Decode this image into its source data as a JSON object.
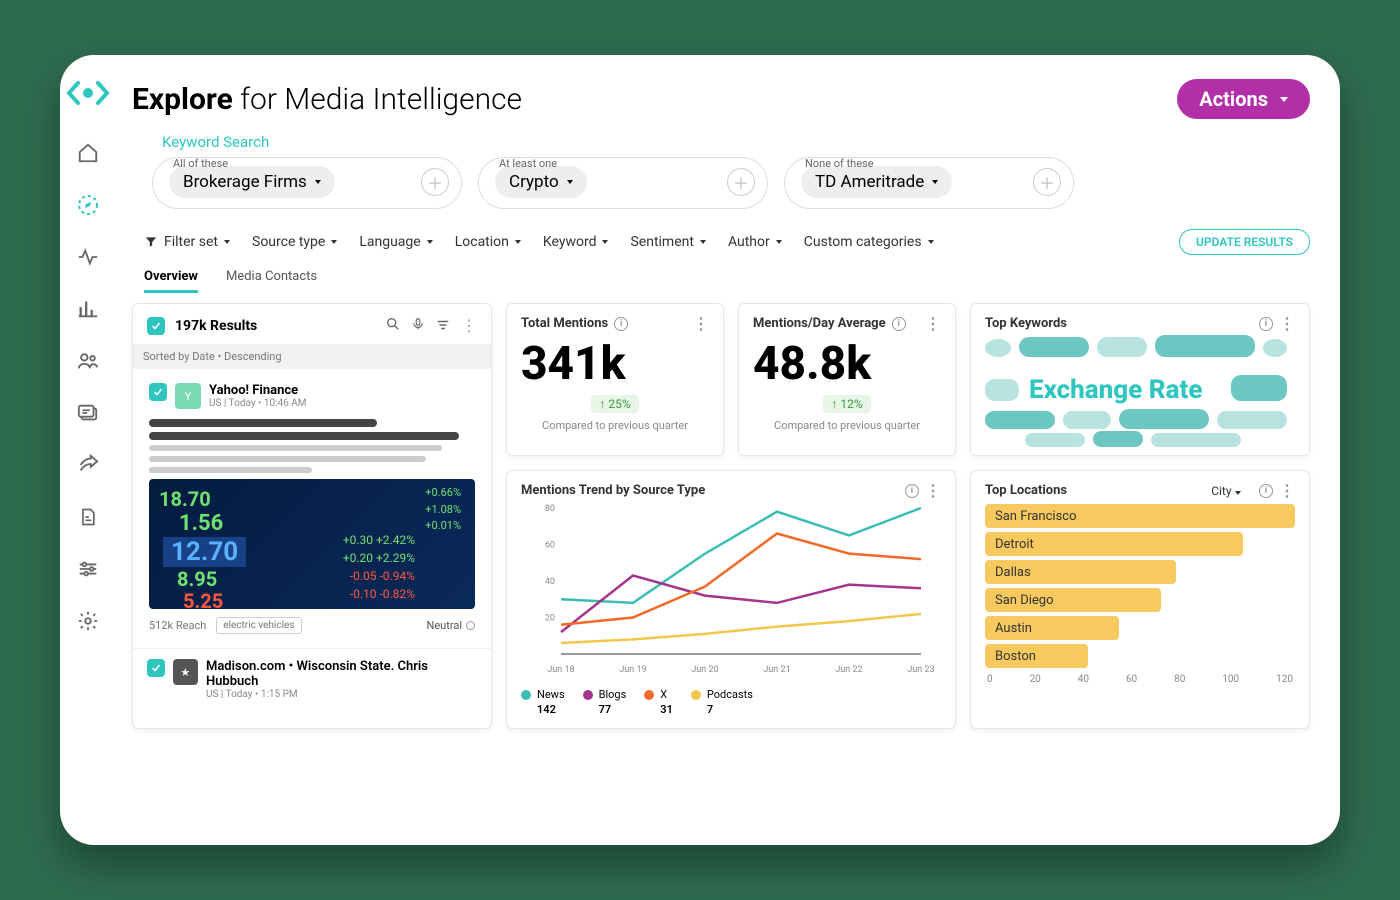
{
  "title_bold": "Explore",
  "title_rest": " for Media Intelligence",
  "actions_label": "Actions",
  "section_label": "Keyword Search",
  "search_groups": [
    {
      "label": "All of these",
      "value": "Brokerage Firms"
    },
    {
      "label": "At least one",
      "value": "Crypto"
    },
    {
      "label": "None of these",
      "value": "TD Ameritrade"
    }
  ],
  "filters": [
    "Filter set",
    "Source type",
    "Language",
    "Location",
    "Keyword",
    "Sentiment",
    "Author",
    "Custom categories"
  ],
  "update_btn": "UPDATE RESULTS",
  "tabs": [
    "Overview",
    "Media Contacts"
  ],
  "results": {
    "count": "197k Results",
    "sort": "Sorted by Date • Descending",
    "article": {
      "source": "Yahoo! Finance",
      "meta": "US  | Today • 10:46 AM",
      "reach": "512k Reach",
      "tag": "electric vehicles",
      "sentiment": "Neutral"
    },
    "next": {
      "line": "Madison.com • Wisconsin State. Chris Hubbuch",
      "meta": "US | Today • 1:15 PM"
    }
  },
  "total_mentions": {
    "title": "Total Mentions",
    "value": "341k",
    "pct": "↑ 25%",
    "compare": "Compared to previous quarter"
  },
  "avg_mentions": {
    "title": "Mentions/Day Average",
    "value": "48.8k",
    "pct": "↑ 12%",
    "compare": "Compared to previous quarter"
  },
  "keywords": {
    "title": "Top Keywords",
    "main": "Exchange Rate"
  },
  "trend": {
    "title": "Mentions Trend by Source Type"
  },
  "locations": {
    "title": "Top Locations",
    "group": "City"
  },
  "chart_data": [
    {
      "type": "line",
      "title": "Mentions Trend by Source Type",
      "xlabel": "",
      "ylabel": "",
      "categories": [
        "Jun 18",
        "Jun 19",
        "Jun 20",
        "Jun 21",
        "Jun 22",
        "Jun 23"
      ],
      "ylim": [
        0,
        80
      ],
      "series": [
        {
          "name": "News",
          "color": "#3bbdb6",
          "values": [
            30,
            28,
            55,
            78,
            65,
            80
          ],
          "legend_value": 142
        },
        {
          "name": "Blogs",
          "color": "#a4358d",
          "values": [
            12,
            43,
            32,
            28,
            38,
            36
          ],
          "legend_value": 77
        },
        {
          "name": "X",
          "color": "#f06a2b",
          "values": [
            16,
            20,
            37,
            66,
            55,
            52
          ],
          "legend_value": 31
        },
        {
          "name": "Podcasts",
          "color": "#f2c84b",
          "values": [
            6,
            8,
            11,
            15,
            18,
            22
          ],
          "legend_value": 7
        }
      ]
    },
    {
      "type": "bar",
      "title": "Top Locations",
      "orientation": "horizontal",
      "xlim": [
        0,
        120
      ],
      "categories": [
        "San Francisco",
        "Detroit",
        "Dallas",
        "San Diego",
        "Austin",
        "Boston"
      ],
      "values": [
        120,
        100,
        74,
        68,
        52,
        40
      ],
      "xticks": [
        0,
        20,
        40,
        60,
        80,
        100,
        120
      ]
    }
  ]
}
